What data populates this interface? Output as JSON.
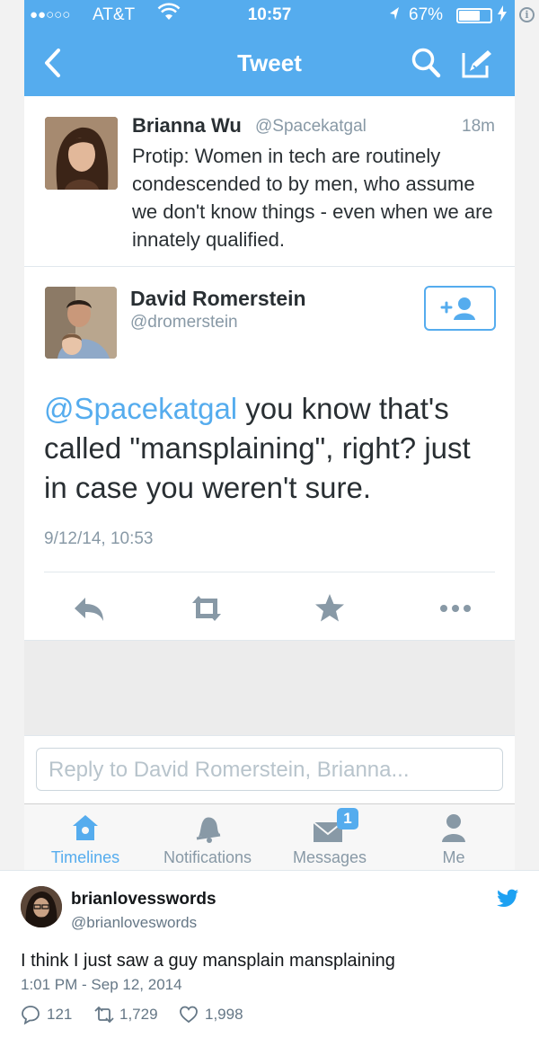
{
  "status_bar": {
    "signal": "●●○○○",
    "carrier": "AT&T",
    "time": "10:57",
    "battery_pct": "67%",
    "battery_level": 0.67
  },
  "nav": {
    "title": "Tweet"
  },
  "parent_tweet": {
    "author_name": "Brianna Wu",
    "author_handle": "@Spacekatgal",
    "age": "18m",
    "text": "Protip: Women in tech are routinely condescended to by men, who assume we don't know things - even when we are innately qualified."
  },
  "main_tweet": {
    "author_name": "David Romerstein",
    "author_handle": "@dromerstein",
    "mention": "@Spacekatgal",
    "text": " you know that's called \"mansplaining\", right? just in case you weren't sure.",
    "timestamp": "9/12/14, 10:53"
  },
  "reply": {
    "placeholder": "Reply to David Romerstein, Brianna..."
  },
  "tabs": [
    {
      "label": "Timelines",
      "icon": "home-icon",
      "active": true
    },
    {
      "label": "Notifications",
      "icon": "bell-icon",
      "active": false
    },
    {
      "label": "Messages",
      "icon": "envelope-icon",
      "active": false,
      "badge": "1"
    },
    {
      "label": "Me",
      "icon": "person-icon",
      "active": false
    }
  ],
  "embed_tweet": {
    "author_name": "brianlovesswords",
    "author_handle": "@brianloveswords",
    "text": "I think I just saw a guy mansplain mansplaining",
    "timestamp": "1:01 PM - Sep 12, 2014",
    "replies": "121",
    "retweets": "1,729",
    "likes": "1,998"
  },
  "colors": {
    "brand": "#55acee",
    "muted": "#8899a6",
    "text": "#292f33"
  }
}
